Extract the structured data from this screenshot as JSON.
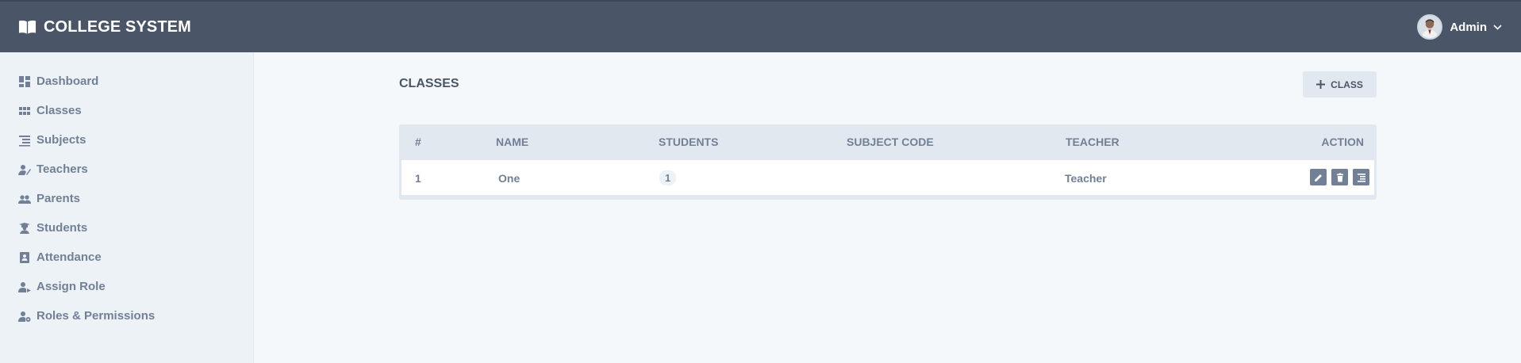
{
  "header": {
    "brand_title": "COLLEGE SYSTEM",
    "brand_icon": "book-icon",
    "user_name": "Admin"
  },
  "sidebar": {
    "items": [
      {
        "label": "Dashboard",
        "icon": "dashboard-icon"
      },
      {
        "label": "Classes",
        "icon": "grid-icon"
      },
      {
        "label": "Subjects",
        "icon": "list-icon"
      },
      {
        "label": "Teachers",
        "icon": "teacher-icon"
      },
      {
        "label": "Parents",
        "icon": "people-icon"
      },
      {
        "label": "Students",
        "icon": "graduation-icon"
      },
      {
        "label": "Attendance",
        "icon": "contact-book-icon"
      },
      {
        "label": "Assign Role",
        "icon": "user-arrow-icon"
      },
      {
        "label": "Roles & Permissions",
        "icon": "user-gear-icon"
      }
    ]
  },
  "main": {
    "title": "CLASSES",
    "add_button_label": "CLASS",
    "table": {
      "headers": [
        "#",
        "NAME",
        "STUDENTS",
        "SUBJECT CODE",
        "TEACHER",
        "ACTION"
      ],
      "rows": [
        {
          "index": "1",
          "name": "One",
          "students": "1",
          "subject_code": "",
          "teacher": "Teacher"
        }
      ]
    }
  },
  "colors": {
    "header_bg": "#4a5568",
    "sidebar_bg": "#edf2f7",
    "page_bg": "#f4f8fb",
    "text_muted": "#718096"
  }
}
